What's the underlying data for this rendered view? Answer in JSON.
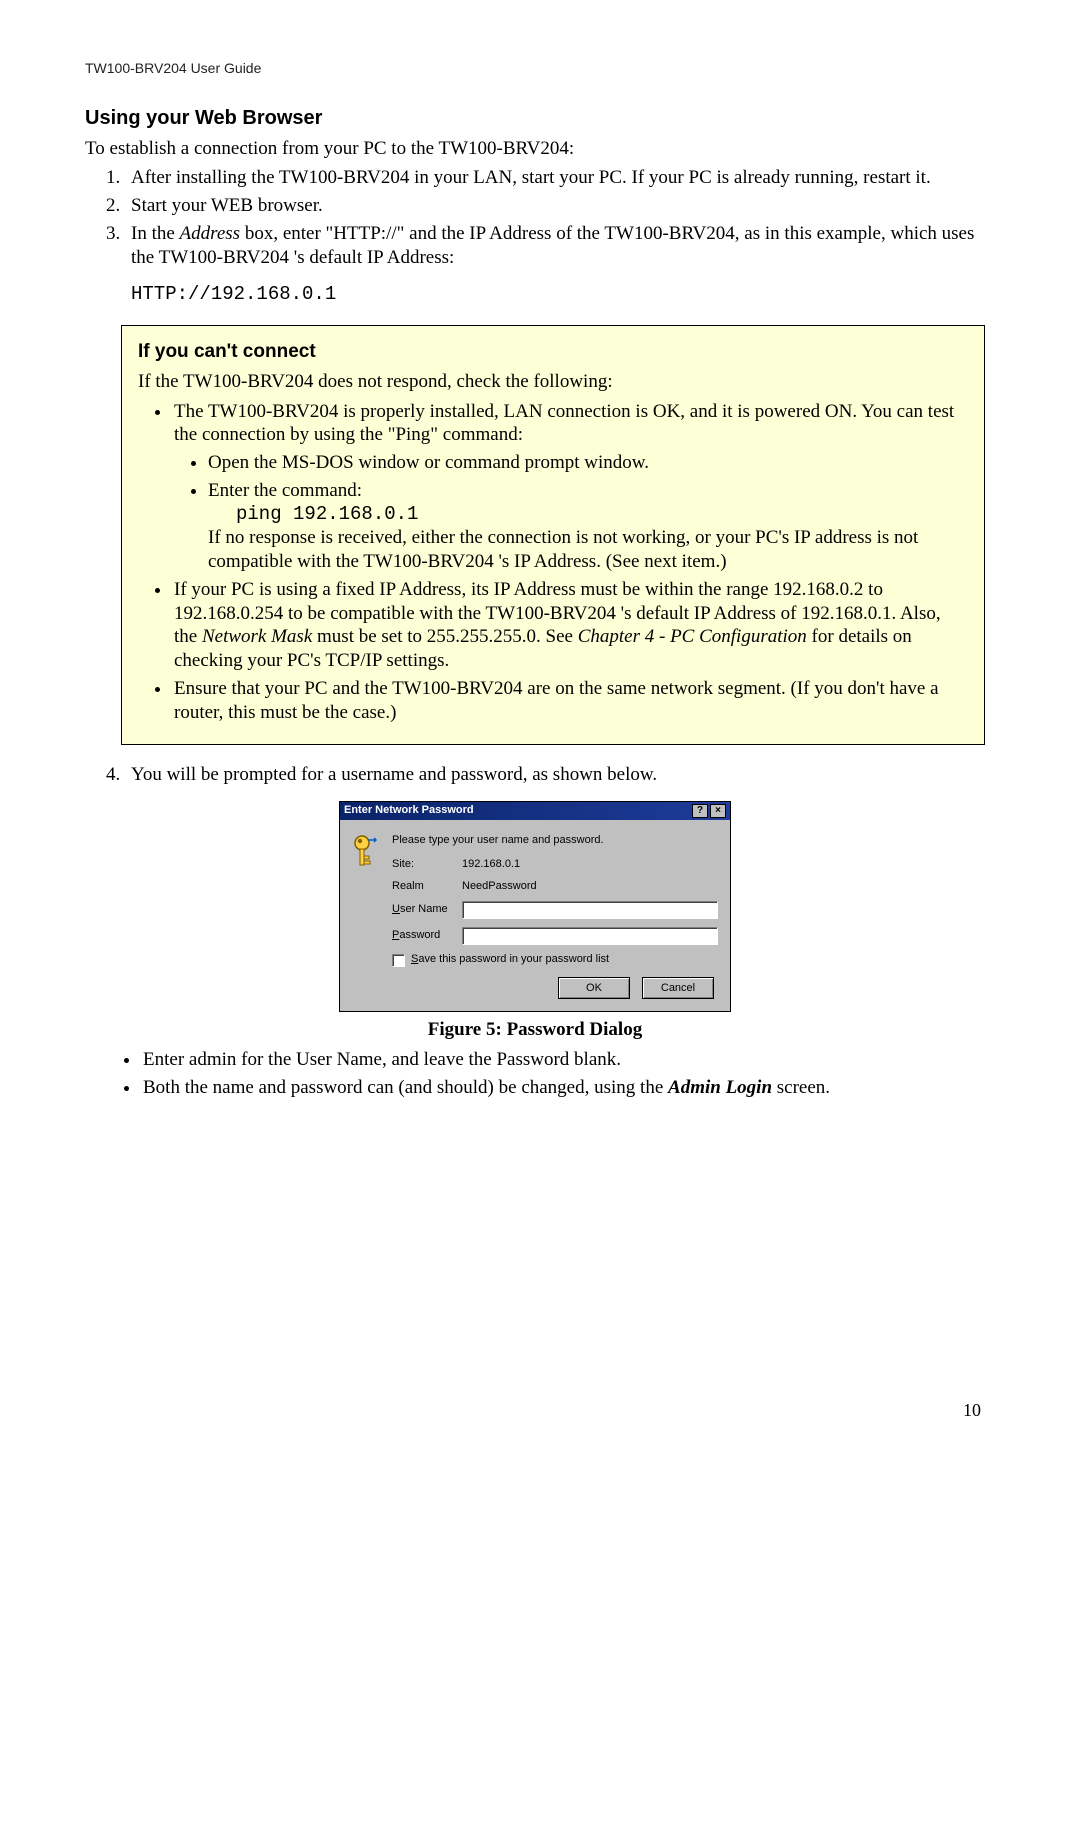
{
  "header": "TW100-BRV204 User Guide",
  "section_title": "Using your Web Browser",
  "intro": "To establish a connection from your PC to the TW100-BRV204:",
  "steps": {
    "s1": "After installing the TW100-BRV204 in your LAN, start your PC. If your PC is already running, restart it.",
    "s2": "Start your WEB browser.",
    "s3a": "In the ",
    "s3_addr": "Address",
    "s3b": " box, enter \"HTTP://\" and the IP Address of the TW100-BRV204, as in this example, which uses the TW100-BRV204 's default IP Address:",
    "s3_code": "HTTP://192.168.0.1",
    "s4": "You will be prompted for a username and password, as shown below."
  },
  "callout": {
    "title": "If you can't connect",
    "intro": "If the TW100-BRV204 does not respond, check the following:",
    "b1": "The TW100-BRV204 is properly installed, LAN connection is OK, and it is powered ON. You can test the connection by using the \"Ping\" command:",
    "b1_sub1": "Open the MS-DOS window or command prompt window.",
    "b1_sub2a": "Enter the command:",
    "b1_sub2_code": "ping 192.168.0.1",
    "b1_sub2b": "If no response is received, either the connection is not working, or your PC's IP address is not compatible with the TW100-BRV204 's IP Address. (See next item.)",
    "b2a": "If your PC is using a fixed IP Address, its IP Address must be within the range 192.168.0.2 to 192.168.0.254 to be compatible with the TW100-BRV204 's default IP Address of 192.168.0.1. Also, the ",
    "b2_nm": "Network Mask",
    "b2b": " must be set to 255.255.255.0. See ",
    "b2_ch": "Chapter 4 - PC Configuration",
    "b2c": " for details on checking your PC's TCP/IP settings.",
    "b3": "Ensure that your PC and the TW100-BRV204 are on the same network segment. (If you don't have a router, this must be the case.)"
  },
  "dialog": {
    "title": "Enter Network Password",
    "help_btn": "?",
    "close_btn": "×",
    "prompt": "Please type your user name and password.",
    "site_label": "Site:",
    "site_value": "192.168.0.1",
    "realm_label": "Realm",
    "realm_value": "NeedPassword",
    "user_label": "User Name",
    "pass_label": "Password",
    "save_label": "Save this password in your password list",
    "ok": "OK",
    "cancel": "Cancel"
  },
  "figure_caption": "Figure 5: Password Dialog",
  "post": {
    "p1": "Enter admin for the User Name, and leave the Password blank.",
    "p2a": "Both the name and password can (and should) be changed, using the ",
    "p2_admin": "Admin Login",
    "p2b": " screen."
  },
  "page_number": "10"
}
